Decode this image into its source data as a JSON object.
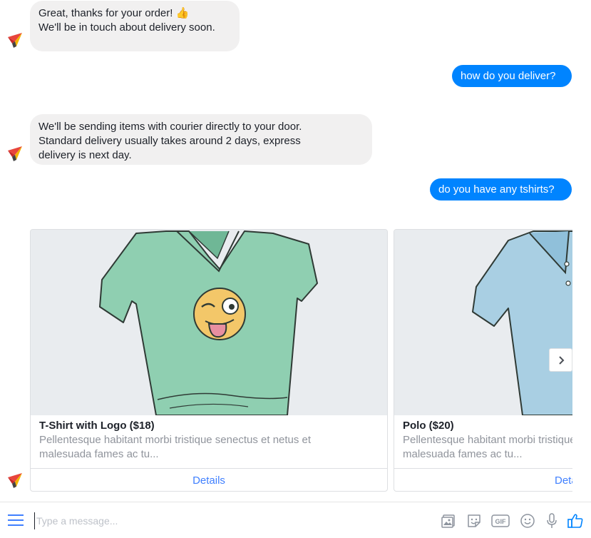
{
  "messages": {
    "bot1": {
      "lines": [
        "Great, thanks for your order! 👍",
        "",
        "We'll be in touch about delivery soon."
      ]
    },
    "user1": {
      "text": "how do you deliver?"
    },
    "bot2": {
      "lines": [
        "We'll be sending items with courier directly to your door.",
        "Standard delivery usually takes around 2 days, express",
        "delivery is next day."
      ]
    },
    "user2": {
      "text": "do you have any tshirts?"
    }
  },
  "carousel": {
    "cards": [
      {
        "title": "T-Shirt with Logo ($18)",
        "subtitle_lines": [
          "Pellentesque habitant morbi tristique senectus et netus et",
          "malesuada fames ac tu..."
        ],
        "action": "Details"
      },
      {
        "title": "Polo ($20)",
        "subtitle_lines": [
          "Pellentesque habitant morbi tristique senectus et netus et",
          "malesuada fames ac tu..."
        ],
        "action": "Details"
      }
    ]
  },
  "composer": {
    "placeholder": "Type a message..."
  },
  "colors": {
    "accent": "#0084ff",
    "bot_bubble": "#f1f0f0",
    "link": "#4080ff",
    "tshirt": "#8fcfb1",
    "polo": "#a9cfe3"
  },
  "icons": [
    "bot-avatar-icon",
    "menu-icon",
    "image-icon",
    "sticker-icon",
    "gif-icon",
    "emoji-icon",
    "microphone-icon",
    "like-icon",
    "chevron-right-icon"
  ]
}
